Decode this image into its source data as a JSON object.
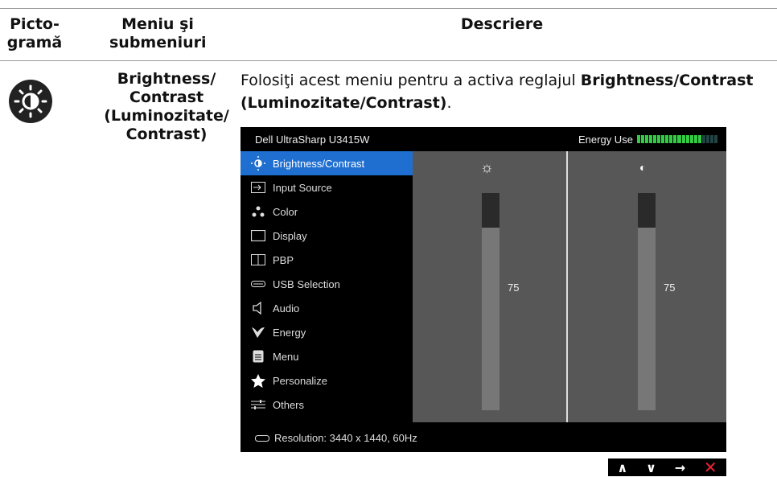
{
  "header": {
    "col1_l1": "Picto-",
    "col1_l2": "gramă",
    "col2_l1": "Meniu şi",
    "col2_l2": "submeniuri",
    "col3": "Descriere"
  },
  "row": {
    "icon": "brightness-contrast-icon",
    "name_l1": "Brightness/",
    "name_l2": "Contrast",
    "name_l3": "(Luminozitate/",
    "name_l4": "Contrast)",
    "desc_prefix": "Folosiţi acest meniu pentru a activa reglajul ",
    "desc_bold": "Brightness/Contrast (Luminozitate/Contrast)",
    "desc_suffix": "."
  },
  "osd": {
    "title": "Dell UltraSharp U3415W",
    "energy_label": "Energy Use",
    "energy_level": 0.8,
    "menu": [
      {
        "label": "Brightness/Contrast",
        "icon": "brightness-icon",
        "active": true
      },
      {
        "label": "Input Source",
        "icon": "input-source-icon"
      },
      {
        "label": "Color",
        "icon": "color-icon"
      },
      {
        "label": "Display",
        "icon": "display-icon"
      },
      {
        "label": "PBP",
        "icon": "pbp-icon"
      },
      {
        "label": "USB Selection",
        "icon": "usb-icon"
      },
      {
        "label": "Audio",
        "icon": "speaker-icon"
      },
      {
        "label": "Energy",
        "icon": "energy-icon"
      },
      {
        "label": "Menu",
        "icon": "menu-icon"
      },
      {
        "label": "Personalize",
        "icon": "star-icon"
      },
      {
        "label": "Others",
        "icon": "others-icon"
      }
    ],
    "brightness": {
      "value": "75",
      "level": 0.84
    },
    "contrast": {
      "value": "75",
      "level": 0.84
    },
    "resolution": "Resolution: 3440 x 1440, 60Hz"
  },
  "nav": [
    "up-arrow-icon",
    "down-arrow-icon",
    "right-arrow-icon",
    "close-icon"
  ],
  "colors": {
    "accent": "#1f6fd1",
    "panel": "#575757",
    "close": "#e23"
  }
}
